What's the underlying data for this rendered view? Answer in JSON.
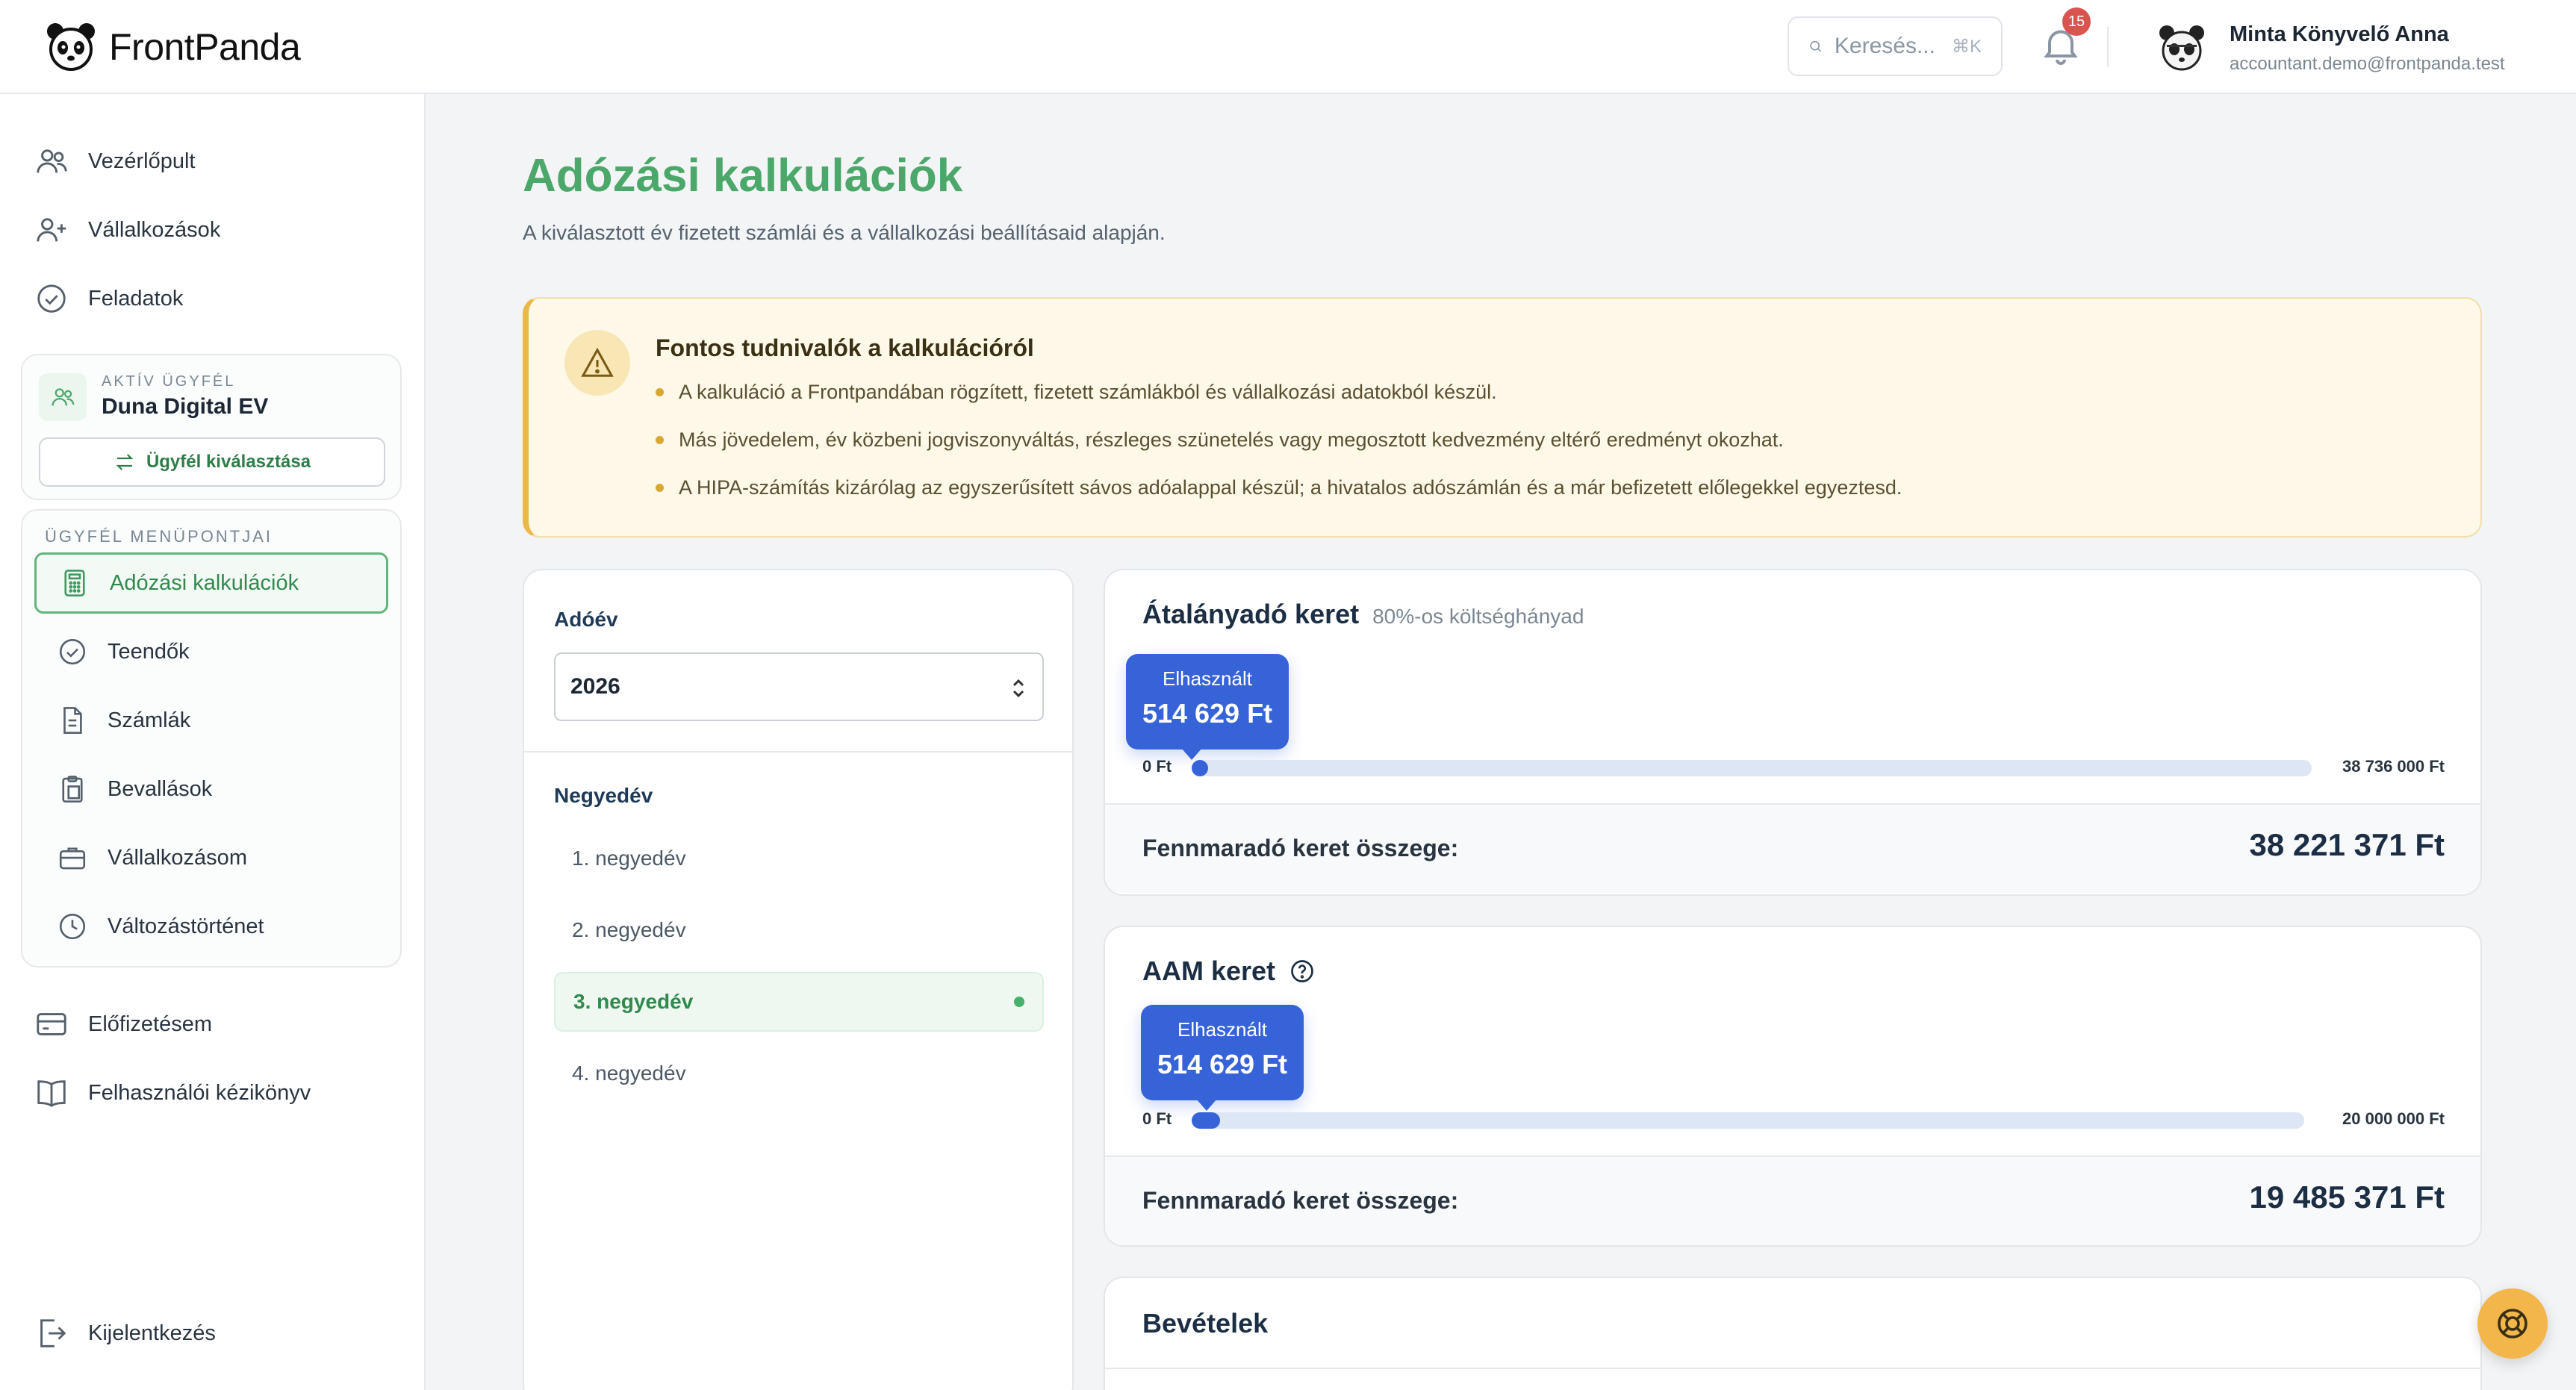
{
  "header": {
    "logo_text": "FrontPanda",
    "search_placeholder": "Keresés...",
    "search_shortcut": "⌘K",
    "notification_count": "15",
    "user_name": "Minta Könyvelő Anna",
    "user_email": "accountant.demo@frontpanda.test"
  },
  "sidebar": {
    "top_items": [
      {
        "label": "Vezérlőpult",
        "icon": "users-icon"
      },
      {
        "label": "Vállalkozások",
        "icon": "user-plus-icon"
      },
      {
        "label": "Feladatok",
        "icon": "check-circle-icon"
      }
    ],
    "active_client": {
      "label": "AKTÍV ÜGYFÉL",
      "name": "Duna Digital EV",
      "button": "Ügyfél kiválasztása"
    },
    "client_menu": {
      "title": "ÜGYFÉL MENÜPONTJAI",
      "items": [
        {
          "label": "Adózási kalkulációk",
          "icon": "calculator-icon",
          "active": true
        },
        {
          "label": "Teendők",
          "icon": "check-circle-icon"
        },
        {
          "label": "Számlák",
          "icon": "document-icon"
        },
        {
          "label": "Bevallások",
          "icon": "clipboard-icon"
        },
        {
          "label": "Vállalkozásom",
          "icon": "briefcase-icon"
        },
        {
          "label": "Változástörténet",
          "icon": "clock-icon"
        }
      ]
    },
    "bottom_items": [
      {
        "label": "Előfizetésem",
        "icon": "credit-card-icon"
      },
      {
        "label": "Felhasználói kézikönyv",
        "icon": "book-icon"
      }
    ],
    "logout": "Kijelentkezés"
  },
  "main": {
    "title": "Adózási kalkulációk",
    "subtitle": "A kiválasztott év fizetett számlái és a vállalkozási beállításaid alapján.",
    "notice": {
      "title": "Fontos tudnivalók a kalkulációról",
      "items": [
        "A kalkuláció a Frontpandában rögzített, fizetett számlákból és vállalkozási adatokból készül.",
        "Más jövedelem, év közbeni jogviszonyváltás, részleges szünetelés vagy megosztott kedvezmény eltérő eredményt okozhat.",
        "A HIPA-számítás kizárólag az egyszerűsített sávos adóalappal készül; a hivatalos adószámlán és a már befizetett előlegekkel egyeztesd."
      ]
    },
    "year": {
      "label": "Adóév",
      "value": "2026"
    },
    "quarter": {
      "label": "Negyedév",
      "items": [
        "1. negyedév",
        "2. negyedév",
        "3. negyedév",
        "4. negyedév"
      ],
      "selected_index": 2
    },
    "frames": [
      {
        "title": "Átalányadó keret",
        "subtitle": "80%-os költséghányad",
        "used_label": "Elhasznált",
        "used_value": "514 629 Ft",
        "min_label": "0 Ft",
        "max_label": "38 736 000 Ft",
        "used_fraction": 0.0133,
        "remaining_label": "Fennmaradó keret összege:",
        "remaining_value": "38 221 371 Ft"
      },
      {
        "title": "AAM keret",
        "subtitle": "",
        "used_label": "Elhasznált",
        "used_value": "514 629 Ft",
        "min_label": "0 Ft",
        "max_label": "20 000 000 Ft",
        "used_fraction": 0.0257,
        "remaining_label": "Fennmaradó keret összege:",
        "remaining_value": "19 485 371 Ft"
      }
    ],
    "income_title": "Bevételek"
  },
  "colors": {
    "brand_green": "#4ca76a",
    "accent_blue": "#3763d8",
    "notice_bg": "#fdf8e7",
    "help_button": "#f2b64a"
  }
}
